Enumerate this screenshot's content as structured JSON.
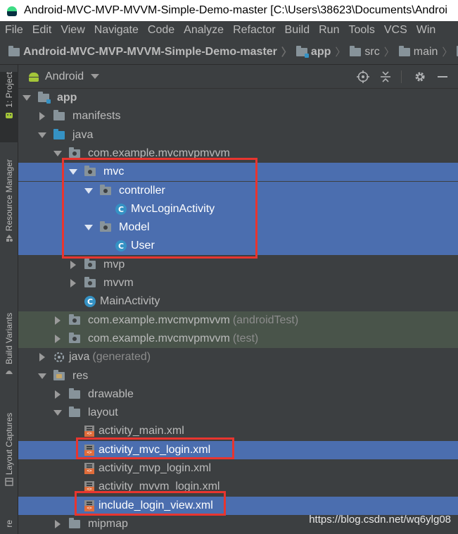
{
  "window": {
    "title": "Android-MVC-MVP-MVVM-Simple-Demo-master [C:\\Users\\38623\\Documents\\Androi"
  },
  "menu": [
    "File",
    "Edit",
    "View",
    "Navigate",
    "Code",
    "Analyze",
    "Refactor",
    "Build",
    "Run",
    "Tools",
    "VCS",
    "Win"
  ],
  "breadcrumb": [
    "Android-MVC-MVP-MVVM-Simple-Demo-master",
    "app",
    "src",
    "main"
  ],
  "left_strip": {
    "project": "1: Project",
    "resource_manager": "Resource Manager",
    "build_variants": "Build Variants",
    "layout_captures": "Layout Captures",
    "bottom": "re"
  },
  "panel": {
    "view_mode": "Android"
  },
  "tree": [
    {
      "label": "app",
      "suffix": "",
      "depth": 0,
      "expander": "open",
      "icon": "module-folder",
      "state": "normal"
    },
    {
      "label": "manifests",
      "suffix": "",
      "depth": 1,
      "expander": "closed",
      "icon": "folder",
      "state": "normal"
    },
    {
      "label": "java",
      "suffix": "",
      "depth": 1,
      "expander": "open",
      "icon": "java-folder",
      "state": "normal"
    },
    {
      "label": "com.example.mvcmvpmvvm",
      "suffix": "",
      "depth": 2,
      "expander": "open",
      "icon": "package",
      "state": "normal"
    },
    {
      "label": "mvc",
      "suffix": "",
      "depth": 3,
      "expander": "open",
      "icon": "package",
      "state": "selected"
    },
    {
      "label": "controller",
      "suffix": "",
      "depth": 4,
      "expander": "open",
      "icon": "package",
      "state": "selected"
    },
    {
      "label": "MvcLoginActivity",
      "suffix": "",
      "depth": 5,
      "expander": "none",
      "icon": "class",
      "state": "selected"
    },
    {
      "label": "Model",
      "suffix": "",
      "depth": 4,
      "expander": "open",
      "icon": "package",
      "state": "selected"
    },
    {
      "label": "User",
      "suffix": "",
      "depth": 5,
      "expander": "none",
      "icon": "class",
      "state": "selected"
    },
    {
      "label": "mvp",
      "suffix": "",
      "depth": 3,
      "expander": "closed",
      "icon": "package",
      "state": "normal"
    },
    {
      "label": "mvvm",
      "suffix": "",
      "depth": 3,
      "expander": "closed",
      "icon": "package",
      "state": "normal"
    },
    {
      "label": "MainActivity",
      "suffix": "",
      "depth": 3,
      "expander": "none",
      "icon": "class",
      "state": "normal"
    },
    {
      "label": "com.example.mvcmvpmvvm",
      "suffix": "(androidTest)",
      "depth": 2,
      "expander": "closed",
      "icon": "package",
      "state": "test"
    },
    {
      "label": "com.example.mvcmvpmvvm",
      "suffix": "(test)",
      "depth": 2,
      "expander": "closed",
      "icon": "package",
      "state": "test"
    },
    {
      "label": "java",
      "suffix": "(generated)",
      "depth": 1,
      "expander": "closed",
      "icon": "generated",
      "state": "normal"
    },
    {
      "label": "res",
      "suffix": "",
      "depth": 1,
      "expander": "open",
      "icon": "res-folder",
      "state": "normal"
    },
    {
      "label": "drawable",
      "suffix": "",
      "depth": 2,
      "expander": "closed",
      "icon": "folder",
      "state": "normal"
    },
    {
      "label": "layout",
      "suffix": "",
      "depth": 2,
      "expander": "open",
      "icon": "folder",
      "state": "normal"
    },
    {
      "label": "activity_main.xml",
      "suffix": "",
      "depth": 3,
      "expander": "none",
      "icon": "xml",
      "state": "normal"
    },
    {
      "label": "activity_mvc_login.xml",
      "suffix": "",
      "depth": 3,
      "expander": "none",
      "icon": "xml",
      "state": "selected"
    },
    {
      "label": "activity_mvp_login.xml",
      "suffix": "",
      "depth": 3,
      "expander": "none",
      "icon": "xml",
      "state": "normal"
    },
    {
      "label": "activity_mvvm_login.xml",
      "suffix": "",
      "depth": 3,
      "expander": "none",
      "icon": "xml",
      "state": "normal"
    },
    {
      "label": "include_login_view.xml",
      "suffix": "",
      "depth": 3,
      "expander": "none",
      "icon": "xml",
      "state": "selected"
    },
    {
      "label": "mipmap",
      "suffix": "",
      "depth": 2,
      "expander": "closed",
      "icon": "folder",
      "state": "normal"
    }
  ],
  "colors": {
    "selection": "#4b6eaf",
    "test_bg": "#49544a",
    "highlight_box": "#e8352f"
  },
  "watermark": "https://blog.csdn.net/wq6ylg08"
}
